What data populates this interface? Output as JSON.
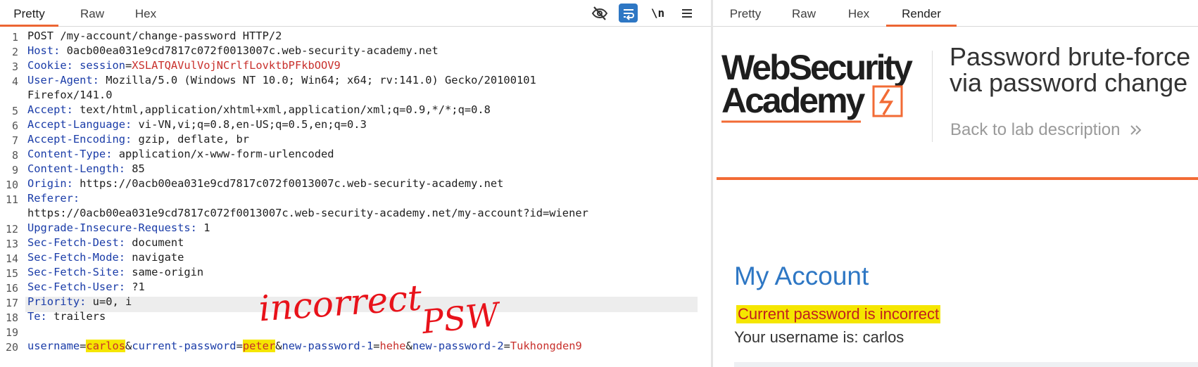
{
  "request_panel": {
    "tabs": [
      "Pretty",
      "Raw",
      "Hex"
    ],
    "active_tab": "Pretty",
    "newline_toggle_label": "\\n",
    "toolbar_icons": [
      "hide-icon",
      "wrap-lines-icon",
      "newline-icon",
      "menu-icon"
    ],
    "line_numbers": [
      "1",
      "2",
      "3",
      "4",
      "5",
      "6",
      "7",
      "8",
      "9",
      "10",
      "11",
      "12",
      "13",
      "14",
      "15",
      "16",
      "17",
      "18",
      "19",
      "20"
    ],
    "request_line": "POST /my-account/change-password HTTP/2",
    "headers": {
      "host_name": "Host:",
      "host_value": " 0acb00ea031e9cd7817c072f0013007c.web-security-academy.net",
      "cookie_name": "Cookie:",
      "cookie_key": " session",
      "cookie_eq": "=",
      "cookie_value": "XSLATQAVulVojNCrlfLovktbPFkbOOV9",
      "ua_name": "User-Agent:",
      "ua_value": " Mozilla/5.0 (Windows NT 10.0; Win64; x64; rv:141.0) Gecko/20100101",
      "ua_value_cont": "Firefox/141.0",
      "accept_name": "Accept:",
      "accept_value": " text/html,application/xhtml+xml,application/xml;q=0.9,*/*;q=0.8",
      "lang_name": "Accept-Language:",
      "lang_value": " vi-VN,vi;q=0.8,en-US;q=0.5,en;q=0.3",
      "enc_name": "Accept-Encoding:",
      "enc_value": " gzip, deflate, br",
      "ctype_name": "Content-Type:",
      "ctype_value": " application/x-www-form-urlencoded",
      "clen_name": "Content-Length:",
      "clen_value": " 85",
      "origin_name": "Origin:",
      "origin_value": " https://0acb00ea031e9cd7817c072f0013007c.web-security-academy.net",
      "referer_name": "Referer:",
      "referer_value": "https://0acb00ea031e9cd7817c072f0013007c.web-security-academy.net/my-account?id=wiener",
      "uir_name": "Upgrade-Insecure-Requests:",
      "uir_value": " 1",
      "sfd_name": "Sec-Fetch-Dest:",
      "sfd_value": " document",
      "sfm_name": "Sec-Fetch-Mode:",
      "sfm_value": " navigate",
      "sfs_name": "Sec-Fetch-Site:",
      "sfs_value": " same-origin",
      "sfu_name": "Sec-Fetch-User:",
      "sfu_value": " ?1",
      "prio_name": "Priority:",
      "prio_value": " u=0, i",
      "te_name": "Te:",
      "te_value": " trailers"
    },
    "body": {
      "p1_name": "username",
      "p1_value": "carlos",
      "p2_name": "current-password",
      "p2_value": "peter",
      "p3_name": "new-password-1",
      "p3_value": "hehe",
      "p4_name": "new-password-2",
      "p4_value": "Tukhongden9",
      "eq": "=",
      "amp": "&"
    },
    "annotation": {
      "text_1": "incorrect",
      "text_2": "PSW",
      "color": "#e8121a"
    },
    "highlight_color": "#f5e600"
  },
  "render_panel": {
    "tabs": [
      "Pretty",
      "Raw",
      "Hex",
      "Render"
    ],
    "active_tab": "Render",
    "logo_line_1": "WebSecurity",
    "logo_line_2": "Academy",
    "lab_title_line_1": "Password brute-force",
    "lab_title_line_2": "via password change",
    "back_link": "Back to lab description",
    "back_link_icon": "double-chevron-right-icon",
    "heading": "My Account",
    "error_message": "Current password is incorrect",
    "username_line": "Your username is: carlos",
    "accent_color": "#f26b35",
    "heading_color": "#2e77c4"
  }
}
